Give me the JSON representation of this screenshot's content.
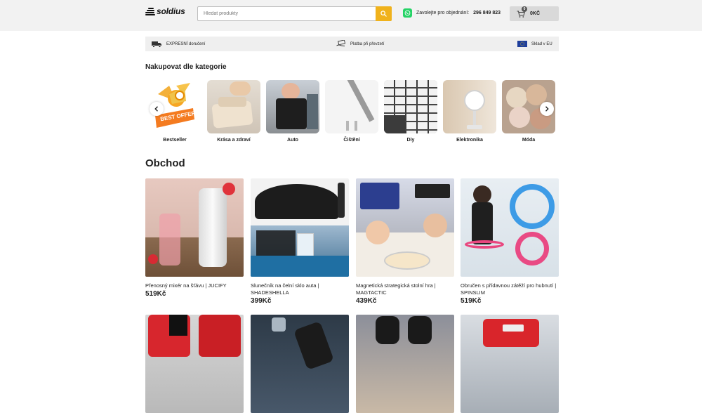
{
  "header": {
    "logo_text": "soldius",
    "search_placeholder": "Hledat produkty",
    "whatsapp_label": "Zavolejte pro objednání:",
    "whatsapp_phone": "296 849 823",
    "cart_count": "0",
    "cart_total": "0KČ"
  },
  "features": [
    {
      "icon": "truck-icon",
      "label": "EXPRESNÍ doručení"
    },
    {
      "icon": "cash-hand-icon",
      "label": "Platba při převzetí"
    },
    {
      "icon": "eu-flag-icon",
      "label": "Sklad v EU"
    }
  ],
  "categories_heading": "Nakupovat dle kategorie",
  "categories": [
    {
      "label": "Bestseller",
      "badge": "BEST OFFER"
    },
    {
      "label": "Krása a zdraví"
    },
    {
      "label": "Auto"
    },
    {
      "label": "Čištění"
    },
    {
      "label": "Diy"
    },
    {
      "label": "Elektronika"
    },
    {
      "label": "Móda"
    }
  ],
  "shop_heading": "Obchod",
  "products": [
    {
      "name": "Přenosný mixér na šťávu | JUCIFY",
      "price": "519Kč"
    },
    {
      "name": "Slunečník na čelní sklo auta | SHADESHELLA",
      "price": "399Kč"
    },
    {
      "name": "Magnetická strategická stolní hra | MAGTACTIC",
      "price": "439Kč"
    },
    {
      "name": "Obručen s přídavnou zátěží pro hubnutí | SPINSLIM",
      "price": "519Kč"
    }
  ],
  "colors": {
    "accent": "#f0b21c",
    "whatsapp": "#25d366",
    "topbar": "#f2f2f2",
    "feature_bar": "#efefef"
  }
}
